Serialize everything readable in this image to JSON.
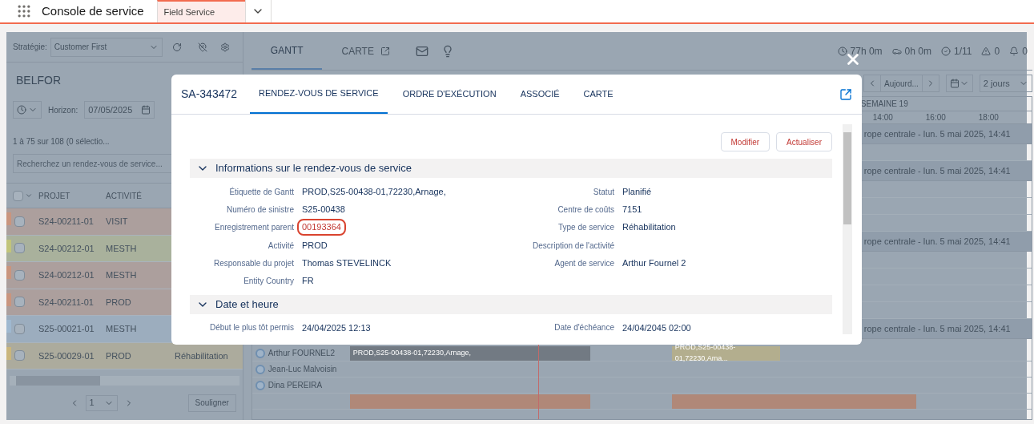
{
  "app_bar": {
    "title": "Console de service",
    "tabs": [
      {
        "label": "Field Service",
        "selected": true
      }
    ]
  },
  "left_panel": {
    "strategy_label": "Stratégie:",
    "strategy_value": "Customer First",
    "title": "BELFOR",
    "horizon_label": "Horizon:",
    "horizon_date": "07/05/2025",
    "count": "1 à 75 sur 108 (0 sélectio...",
    "search": {
      "placeholder": "Recherchez un rendez-vous de service..."
    },
    "columns": [
      "PROJET",
      "ACTIVITÉ"
    ],
    "select_all_checked": false,
    "rows": [
      {
        "project": "S24-00211-01",
        "activity": "VISIT",
        "color": "#c9957e",
        "checked": false
      },
      {
        "project": "S24-00212-01",
        "activity": "MESTH",
        "color": "#c1c47a",
        "checked": false
      },
      {
        "project": "S24-00212-01",
        "activity": "MESTH",
        "color": "#c9957e",
        "checked": false
      },
      {
        "project": "S24-00211-01",
        "activity": "PROD",
        "color": "#c9957e",
        "checked": false
      },
      {
        "project": "S25-00021-01",
        "activity": "MESTH",
        "color": "#9fb8d0",
        "checked": false
      },
      {
        "project": "S25-00029-01",
        "activity": "PROD",
        "column_3": "Réhabilitation",
        "color": "#c9b57c",
        "checked": false
      }
    ],
    "page": "1",
    "highlight_button": "Souligner"
  },
  "gantt": {
    "tabs": [
      {
        "label": "GANTT",
        "selected": true
      },
      {
        "label": "CARTE",
        "selected": false
      }
    ],
    "stats": [
      {
        "kind": "time",
        "value": "77h 0m"
      },
      {
        "kind": "travel",
        "value": "0h 0m"
      },
      {
        "kind": "done",
        "value": "1/11"
      },
      {
        "kind": "warning",
        "value": "0"
      },
      {
        "kind": "alert",
        "value": "0"
      }
    ],
    "today": "Aujourd...",
    "range": "2 jours",
    "week": "SEMAINE 19",
    "hours": [
      "14:00",
      "16:00",
      "18:00"
    ],
    "groups": [
      "rope centrale - lun. 5 mai 2025, 14:41",
      "rope centrale - lun. 5 mai 2025, 14:41",
      "rope centrale - lun. 5 mai 2025, 14:41",
      "rope centrale - lun. 5 mai 2025, 14:41"
    ],
    "resources": [
      {
        "name": "Arthur FOURNEL2",
        "bars": [
          {
            "label": "PROD,S25-00438-01,72230,Arnage,",
            "color": "#727a83"
          },
          {
            "label": "PROD,S25-00438-01,72230,Ama...",
            "color": "#b3ae8e"
          }
        ]
      },
      {
        "name": "Jean-Luc Malvoisin"
      },
      {
        "name": "Dina PEREIRA"
      },
      {
        "bars": [
          {
            "color": "#b08878"
          },
          {
            "color": "#b08878"
          }
        ]
      }
    ]
  },
  "modal": {
    "record": "SA-343472",
    "tabs": [
      {
        "label": "RENDEZ-VOUS DE SERVICE",
        "selected": true
      },
      {
        "label": "ORDRE D'EXÉCUTION",
        "selected": false
      },
      {
        "label": "ASSOCIÉ",
        "selected": false
      },
      {
        "label": "CARTE",
        "selected": false
      }
    ],
    "buttons": [
      "Modifier",
      "Actualiser"
    ],
    "sections": [
      {
        "title": "Informations sur le rendez-vous de service",
        "expanded": true,
        "fields": [
          [
            {
              "label": "Étiquette de Gantt",
              "value": "PROD,S25-00438-01,72230,Arnage,"
            },
            {
              "label": "Statut",
              "value": "Planifié"
            }
          ],
          [
            {
              "label": "Numéro de sinistre",
              "value": "S25-00438"
            },
            {
              "label": "Centre de coûts",
              "value": "7151"
            }
          ],
          [
            {
              "label": "Enregistrement parent",
              "value": "00193364",
              "highlighted": true
            },
            {
              "label": "Type de service",
              "value": "Réhabilitation"
            }
          ],
          [
            {
              "label": "Activité",
              "value": "PROD"
            },
            {
              "label": "Description de l'activité"
            }
          ],
          [
            {
              "label": "Responsable du projet",
              "value": "Thomas STEVELINCK"
            },
            {
              "label": "Agent de service",
              "value": "Arthur Fournel 2"
            }
          ],
          [
            {
              "label": "Entity Country",
              "value": "FR"
            }
          ]
        ]
      },
      {
        "title": "Date et heure",
        "expanded": true,
        "fields": [
          [
            {
              "label": "Début le plus tôt permis",
              "value": "24/04/2025 12:13"
            },
            {
              "label": "Date d'échéance",
              "value": "24/04/2045 02:00"
            }
          ]
        ]
      }
    ]
  }
}
